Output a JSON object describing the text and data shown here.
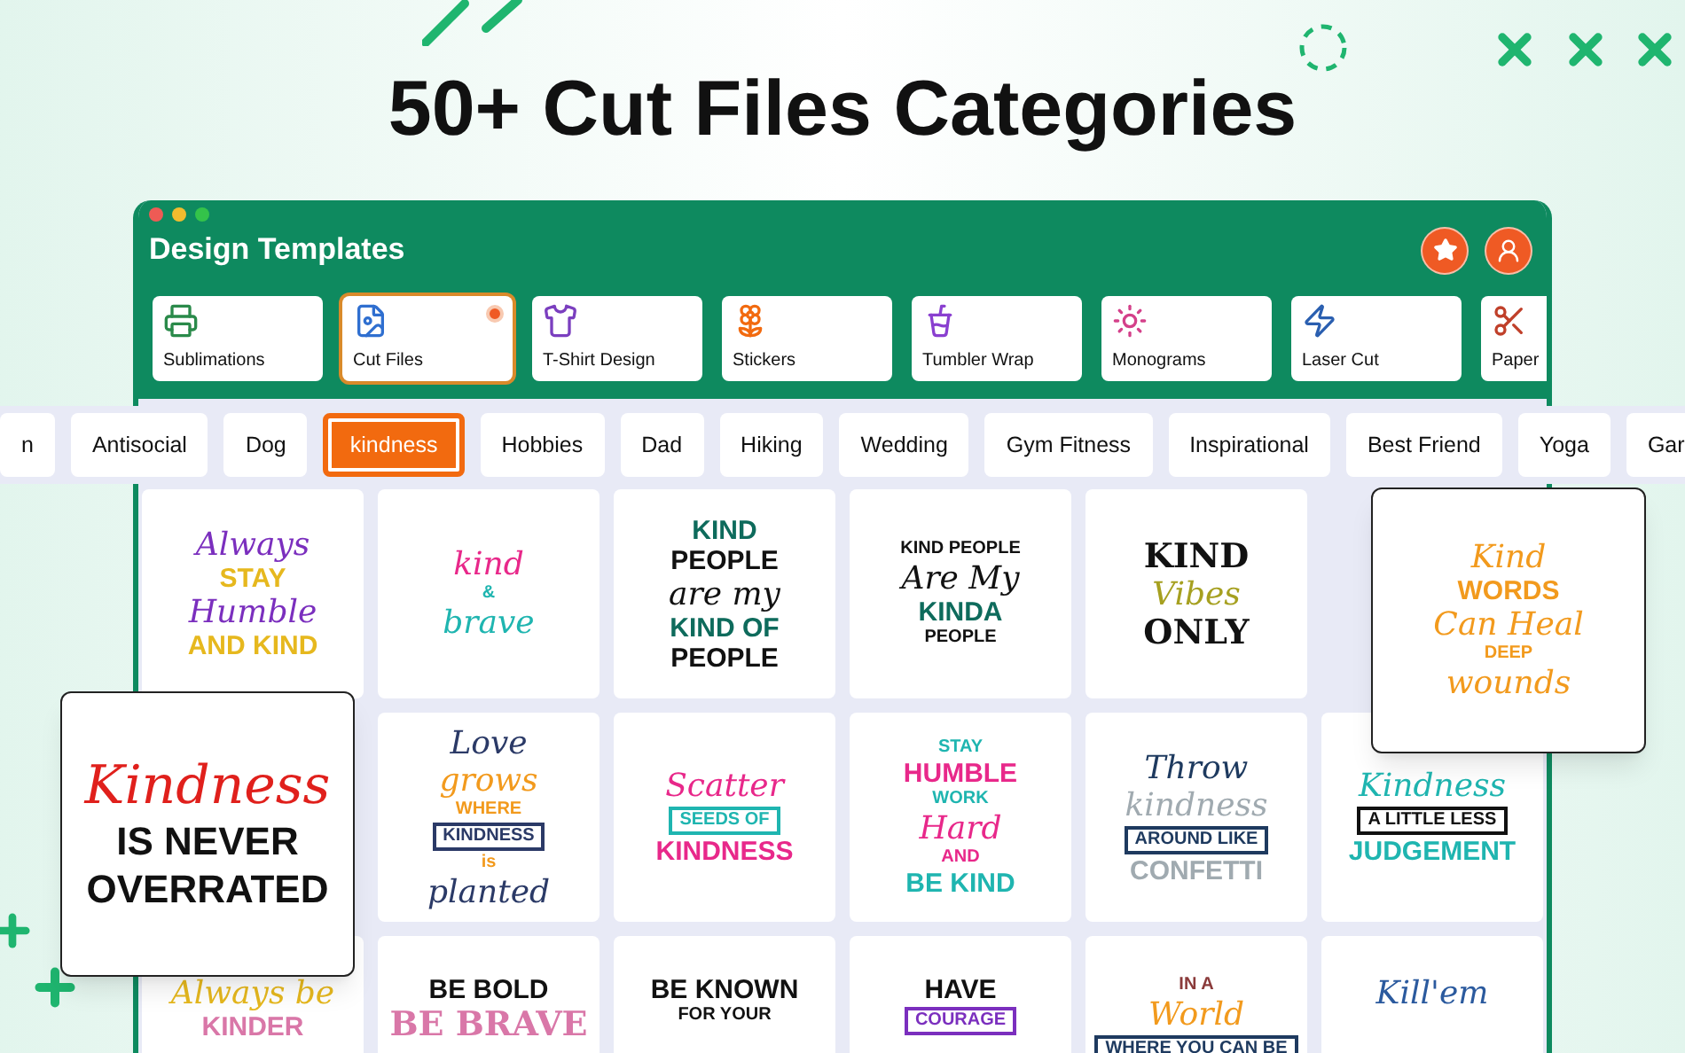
{
  "headline": "50+ Cut Files Categories",
  "window": {
    "title": "Design Templates"
  },
  "categories": [
    {
      "label": "Sublimations",
      "selected": false,
      "dot": false
    },
    {
      "label": "Cut Files",
      "selected": true,
      "dot": true
    },
    {
      "label": "T-Shirt Design",
      "selected": false,
      "dot": false
    },
    {
      "label": "Stickers",
      "selected": false,
      "dot": false
    },
    {
      "label": "Tumbler Wrap",
      "selected": false,
      "dot": false
    },
    {
      "label": "Monograms",
      "selected": false,
      "dot": false
    },
    {
      "label": "Laser Cut",
      "selected": false,
      "dot": false
    },
    {
      "label": "Paper",
      "selected": false,
      "dot": false
    }
  ],
  "tags": [
    {
      "label": "n",
      "selected": false
    },
    {
      "label": "Antisocial",
      "selected": false
    },
    {
      "label": "Dog",
      "selected": false
    },
    {
      "label": "kindness",
      "selected": true
    },
    {
      "label": "Hobbies",
      "selected": false
    },
    {
      "label": "Dad",
      "selected": false
    },
    {
      "label": "Hiking",
      "selected": false
    },
    {
      "label": "Wedding",
      "selected": false
    },
    {
      "label": "Gym Fitness",
      "selected": false
    },
    {
      "label": "Inspirational",
      "selected": false
    },
    {
      "label": "Best Friend",
      "selected": false
    },
    {
      "label": "Yoga",
      "selected": false
    },
    {
      "label": "Gar",
      "selected": false
    }
  ],
  "designs": [
    {
      "covered": false,
      "lines": [
        {
          "text": "Always",
          "kind": "script",
          "color": "#7b2fbe"
        },
        {
          "text": "STAY",
          "kind": "block",
          "color": "#e6b81e"
        },
        {
          "text": "Humble",
          "kind": "script",
          "color": "#7b2fbe"
        },
        {
          "text": "AND KIND",
          "kind": "block",
          "color": "#e6b81e"
        }
      ]
    },
    {
      "covered": false,
      "lines": [
        {
          "text": "kind",
          "kind": "script",
          "color": "#e8288a"
        },
        {
          "text": "&",
          "kind": "small",
          "color": "#1fb5b0"
        },
        {
          "text": "brave",
          "kind": "script",
          "color": "#1fb5b0"
        }
      ]
    },
    {
      "covered": false,
      "lines": [
        {
          "text": "KIND",
          "kind": "block",
          "color": "#0e6b5c"
        },
        {
          "text": "PEOPLE",
          "kind": "block",
          "color": "#111111"
        },
        {
          "text": "are my",
          "kind": "script",
          "color": "#111111"
        },
        {
          "text": "KIND OF",
          "kind": "block",
          "color": "#0e6b5c"
        },
        {
          "text": "PEOPLE",
          "kind": "block",
          "color": "#111111"
        }
      ]
    },
    {
      "covered": false,
      "lines": [
        {
          "text": "KIND PEOPLE",
          "kind": "small",
          "color": "#111111"
        },
        {
          "text": "Are My",
          "kind": "script",
          "color": "#111111"
        },
        {
          "text": "KINDA",
          "kind": "block",
          "color": "#0e6b5c"
        },
        {
          "text": "PEOPLE",
          "kind": "small",
          "color": "#111111"
        }
      ]
    },
    {
      "covered": false,
      "lines": [
        {
          "text": "KIND",
          "kind": "serif",
          "color": "#111111"
        },
        {
          "text": "Vibes",
          "kind": "script",
          "color": "#a6a020"
        },
        {
          "text": "ONLY",
          "kind": "serif",
          "color": "#111111"
        }
      ]
    },
    {
      "covered": true
    },
    {
      "covered": true
    },
    {
      "covered": false,
      "lines": [
        {
          "text": "Love",
          "kind": "script",
          "color": "#2b3a67"
        },
        {
          "text": "grows",
          "kind": "script",
          "color": "#f29a1d"
        },
        {
          "text": "WHERE",
          "kind": "small",
          "color": "#f29a1d"
        },
        {
          "text": "KINDNESS",
          "kind": "boxed",
          "color": "#2b3a67"
        },
        {
          "text": "is",
          "kind": "small",
          "color": "#f29a1d"
        },
        {
          "text": "planted",
          "kind": "script",
          "color": "#2b3a67"
        }
      ]
    },
    {
      "covered": false,
      "lines": [
        {
          "text": "Scatter",
          "kind": "script",
          "color": "#e8288a"
        },
        {
          "text": "SEEDS OF",
          "kind": "boxed",
          "color": "#1fb5b0"
        },
        {
          "text": "KINDNESS",
          "kind": "block",
          "color": "#e8288a"
        }
      ]
    },
    {
      "covered": false,
      "lines": [
        {
          "text": "STAY",
          "kind": "small",
          "color": "#1fb5b0"
        },
        {
          "text": "HUMBLE",
          "kind": "block",
          "color": "#e8288a"
        },
        {
          "text": "WORK",
          "kind": "small",
          "color": "#1fb5b0"
        },
        {
          "text": "Hard",
          "kind": "script",
          "color": "#e8288a"
        },
        {
          "text": "AND",
          "kind": "small",
          "color": "#e8288a"
        },
        {
          "text": "BE KIND",
          "kind": "block",
          "color": "#1fb5b0"
        }
      ]
    },
    {
      "covered": false,
      "lines": [
        {
          "text": "Throw",
          "kind": "script",
          "color": "#1e3a5f"
        },
        {
          "text": "kindness",
          "kind": "script",
          "color": "#a0aab0"
        },
        {
          "text": "AROUND LIKE",
          "kind": "boxed",
          "color": "#1e3a5f"
        },
        {
          "text": "CONFETTI",
          "kind": "block",
          "color": "#a0aab0"
        }
      ]
    },
    {
      "covered": false,
      "lines": [
        {
          "text": "Kindness",
          "kind": "script",
          "color": "#1fb5b0"
        },
        {
          "text": "A LITTLE LESS",
          "kind": "boxed",
          "color": "#111111"
        },
        {
          "text": "JUDGEMENT",
          "kind": "block",
          "color": "#1fb5b0"
        }
      ]
    },
    {
      "covered": false,
      "lines": [
        {
          "text": "Always be",
          "kind": "script",
          "color": "#e6b81e"
        },
        {
          "text": "KINDER",
          "kind": "block",
          "color": "#d977a8"
        }
      ]
    },
    {
      "covered": false,
      "lines": [
        {
          "text": "BE BOLD",
          "kind": "block",
          "color": "#111111"
        },
        {
          "text": "BE BRAVE",
          "kind": "serif",
          "color": "#d977a8"
        }
      ]
    },
    {
      "covered": false,
      "lines": [
        {
          "text": "BE KNOWN",
          "kind": "block",
          "color": "#111111"
        },
        {
          "text": "FOR YOUR",
          "kind": "small",
          "color": "#111111"
        }
      ]
    },
    {
      "covered": false,
      "lines": [
        {
          "text": "HAVE",
          "kind": "block",
          "color": "#111111"
        },
        {
          "text": "COURAGE",
          "kind": "boxed",
          "color": "#7b2fbe"
        }
      ]
    },
    {
      "covered": false,
      "lines": [
        {
          "text": "IN A",
          "kind": "small",
          "color": "#8a3a3a"
        },
        {
          "text": "World",
          "kind": "script",
          "color": "#f29a1d"
        },
        {
          "text": "WHERE YOU CAN BE",
          "kind": "boxed",
          "color": "#1e3a5f"
        }
      ]
    },
    {
      "covered": false,
      "lines": [
        {
          "text": "Kill'em",
          "kind": "script",
          "color": "#2b5a9e"
        }
      ]
    }
  ],
  "featured_designs": [
    {
      "lines": [
        {
          "text": "Kindness",
          "kind": "script",
          "color": "#e0201c"
        },
        {
          "text": "IS NEVER",
          "kind": "block",
          "color": "#111111"
        },
        {
          "text": "OVERRATED",
          "kind": "block",
          "color": "#111111"
        }
      ]
    },
    {
      "lines": [
        {
          "text": "Kind",
          "kind": "script",
          "color": "#f29a1d"
        },
        {
          "text": "WORDS",
          "kind": "block",
          "color": "#f29a1d"
        },
        {
          "text": "Can Heal",
          "kind": "script",
          "color": "#f29a1d"
        },
        {
          "text": "DEEP",
          "kind": "small",
          "color": "#f29a1d"
        },
        {
          "text": "wounds",
          "kind": "script",
          "color": "#f29a1d"
        }
      ]
    }
  ]
}
